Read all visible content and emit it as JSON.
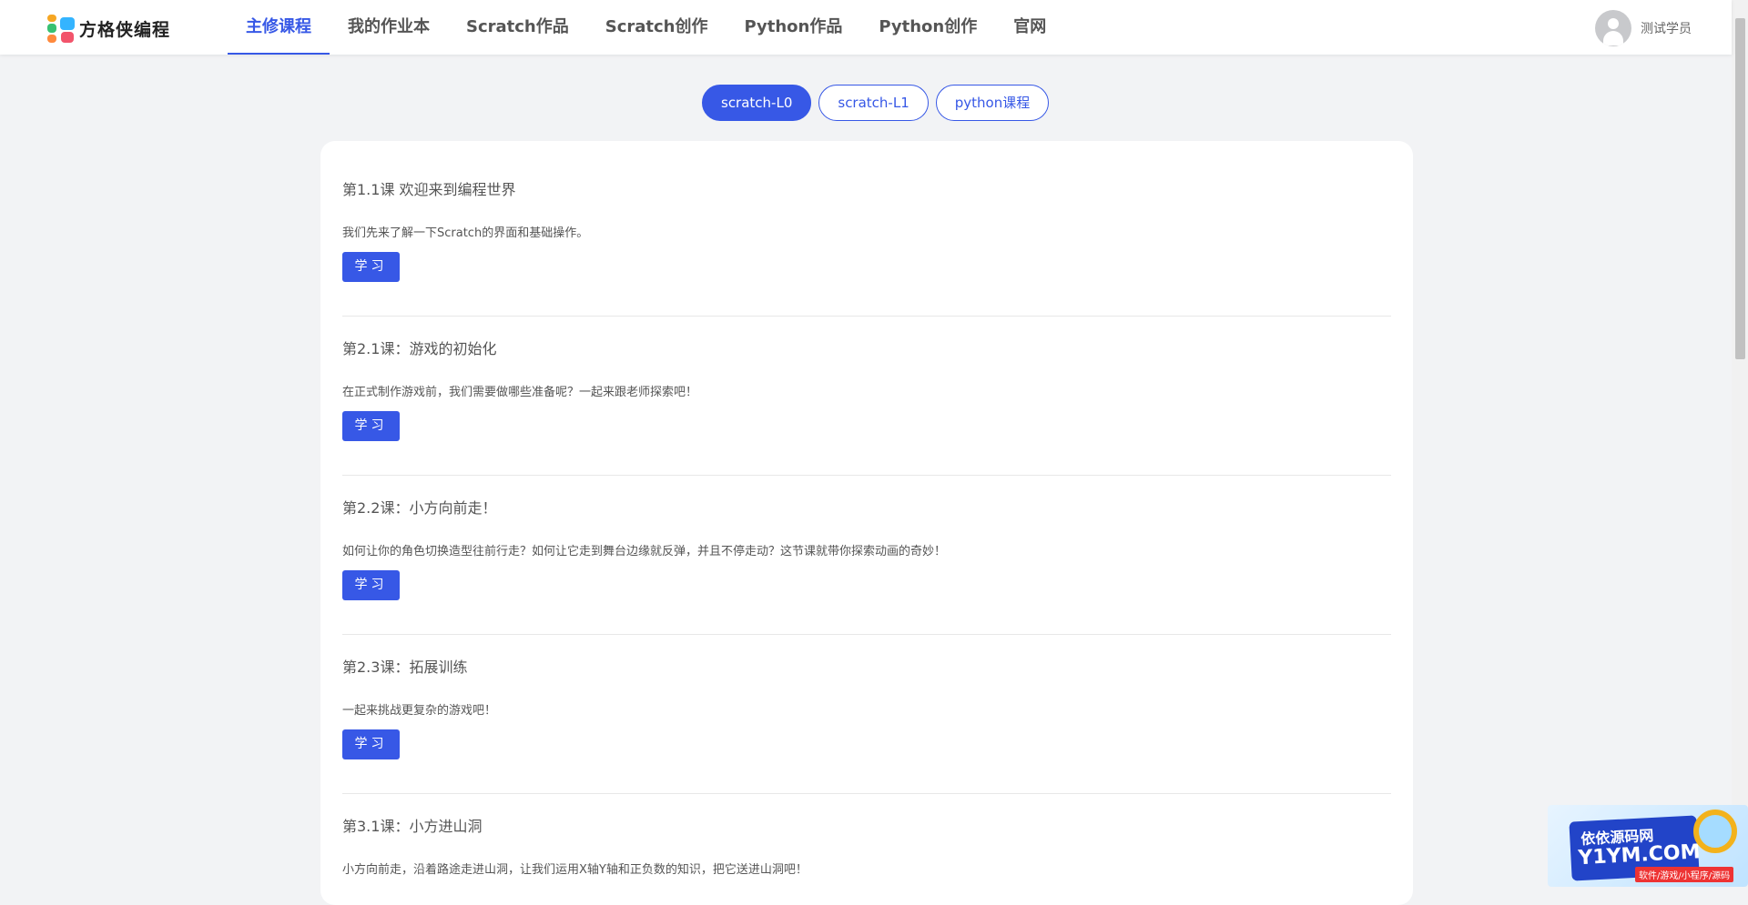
{
  "app": {
    "logo_text": "方格侠编程"
  },
  "nav": {
    "items": [
      {
        "label": "主修课程",
        "active": true
      },
      {
        "label": "我的作业本"
      },
      {
        "label": "Scratch作品"
      },
      {
        "label": "Scratch创作"
      },
      {
        "label": "Python作品"
      },
      {
        "label": "Python创作"
      },
      {
        "label": "官网"
      }
    ]
  },
  "user": {
    "name": "测试学员",
    "icon": "user-avatar-icon"
  },
  "course_tabs": [
    {
      "label": "scratch-L0",
      "active": true
    },
    {
      "label": "scratch-L1"
    },
    {
      "label": "python课程"
    }
  ],
  "lessons": [
    {
      "title": "第1.1课 欢迎来到编程世界",
      "desc": "我们先来了解一下Scratch的界面和基础操作。",
      "button": "学习"
    },
    {
      "title": "第2.1课：游戏的初始化",
      "desc": "在正式制作游戏前，我们需要做哪些准备呢？一起来跟老师探索吧！",
      "button": "学习"
    },
    {
      "title": "第2.2课：小方向前走！",
      "desc": "如何让你的角色切换造型往前行走？如何让它走到舞台边缘就反弹，并且不停走动？这节课就带你探索动画的奇妙！",
      "button": "学习"
    },
    {
      "title": "第2.3课：拓展训练",
      "desc": "一起来挑战更复杂的游戏吧！",
      "button": "学习"
    },
    {
      "title": "第3.1课：小方进山洞",
      "desc": "小方向前走，沿着路途走进山洞，让我们运用X轴Y轴和正负数的知识，把它送进山洞吧！",
      "button": "学习"
    }
  ],
  "watermark": {
    "line1": "依依源码网",
    "line2": "Y1YM.COM",
    "sub": "软件/游戏/小程序/源码"
  },
  "colors": {
    "accent": "#3758e6",
    "background": "#f2f3f5"
  }
}
